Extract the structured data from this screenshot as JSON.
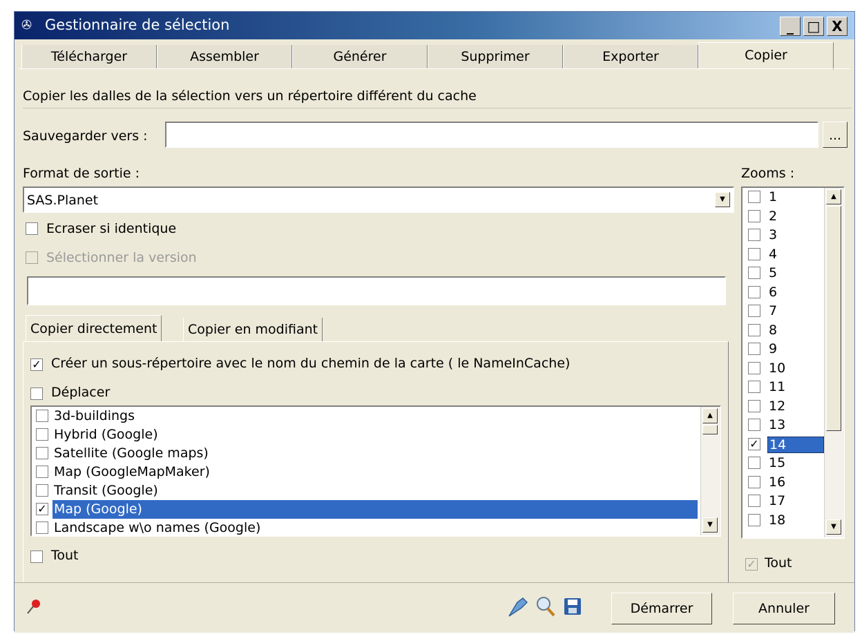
{
  "window": {
    "title": "Gestionnaire de sélection",
    "buttons": {
      "minimize": "_",
      "maximize": "□",
      "close": "X"
    }
  },
  "tabs": [
    "Télécharger",
    "Assembler",
    "Générer",
    "Supprimer",
    "Exporter",
    "Copier"
  ],
  "active_tab": "Copier",
  "copy": {
    "description": "Copier les dalles de la sélection vers un répertoire différent du cache",
    "save_label": "Sauvegarder vers :",
    "save_value": "",
    "browse_label": "...",
    "format_label": "Format de sortie :",
    "format_value": "SAS.Planet",
    "overwrite_label": "Ecraser si identique",
    "overwrite_checked": false,
    "version_label": "Sélectionner la version",
    "version_value": "",
    "subtabs": [
      "Copier directement",
      "Copier en modifiant"
    ],
    "create_subdir_label": "Créer un sous-répertoire avec le nom du chemin de la carte ( le NameInCache)",
    "create_subdir_checked": true,
    "move_label": "Déplacer",
    "maps": [
      {
        "label": "3d-buildings",
        "checked": false,
        "selected": false
      },
      {
        "label": "Hybrid (Google)",
        "checked": false,
        "selected": false
      },
      {
        "label": "Satellite (Google maps)",
        "checked": false,
        "selected": false
      },
      {
        "label": "Map (GoogleMapMaker)",
        "checked": false,
        "selected": false
      },
      {
        "label": "Transit (Google)",
        "checked": false,
        "selected": false
      },
      {
        "label": "Map (Google)",
        "checked": true,
        "selected": true
      },
      {
        "label": "Landscape w\\o names (Google)",
        "checked": false,
        "selected": false
      }
    ],
    "all_maps_label": "Tout",
    "zooms_label": "Zooms :",
    "zooms": [
      {
        "label": "1",
        "checked": false
      },
      {
        "label": "2",
        "checked": false
      },
      {
        "label": "3",
        "checked": false
      },
      {
        "label": "4",
        "checked": false
      },
      {
        "label": "5",
        "checked": false
      },
      {
        "label": "6",
        "checked": false
      },
      {
        "label": "7",
        "checked": false
      },
      {
        "label": "8",
        "checked": false
      },
      {
        "label": "9",
        "checked": false
      },
      {
        "label": "10",
        "checked": false
      },
      {
        "label": "11",
        "checked": false
      },
      {
        "label": "12",
        "checked": false
      },
      {
        "label": "13",
        "checked": false
      },
      {
        "label": "14",
        "checked": true,
        "selected": true
      },
      {
        "label": "15",
        "checked": false
      },
      {
        "label": "16",
        "checked": false
      },
      {
        "label": "17",
        "checked": false
      },
      {
        "label": "18",
        "checked": false
      }
    ],
    "all_zooms_label": "Tout"
  },
  "footer": {
    "start_label": "Démarrer",
    "cancel_label": "Annuler"
  },
  "colors": {
    "selection": "#316ac5",
    "window_bg": "#ece9d8"
  }
}
